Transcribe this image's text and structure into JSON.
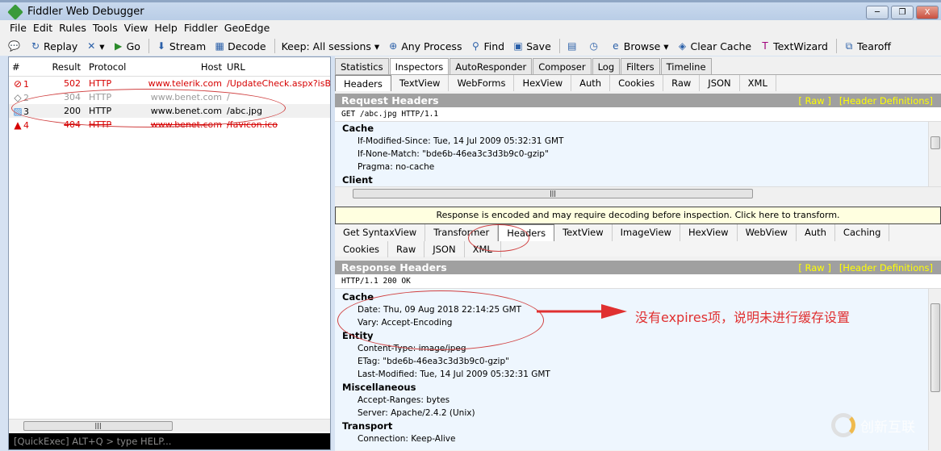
{
  "window": {
    "title": "Fiddler Web Debugger",
    "minimize": "─",
    "restore": "❐",
    "close": "X"
  },
  "menu": [
    "File",
    "Edit",
    "Rules",
    "Tools",
    "View",
    "Help",
    "Fiddler",
    "GeoEdge"
  ],
  "toolbar": [
    {
      "icon": "comment-icon",
      "label": ""
    },
    {
      "icon": "replay-icon",
      "label": "Replay"
    },
    {
      "icon": "remove-icon",
      "label": "▾"
    },
    {
      "icon": "go-icon",
      "label": "Go"
    },
    {
      "icon": "stream-icon",
      "label": "Stream"
    },
    {
      "icon": "decode-icon",
      "label": "Decode"
    },
    {
      "icon": "",
      "label": "Keep: All sessions ▾"
    },
    {
      "icon": "any-process-icon",
      "label": "Any Process"
    },
    {
      "icon": "find-icon",
      "label": "Find"
    },
    {
      "icon": "save-icon",
      "label": "Save"
    },
    {
      "icon": "screenshot-icon",
      "label": ""
    },
    {
      "icon": "timer-icon",
      "label": ""
    },
    {
      "icon": "browse-icon",
      "label": "Browse ▾"
    },
    {
      "icon": "clear-cache-icon",
      "label": "Clear Cache"
    },
    {
      "icon": "textwizard-icon",
      "label": "TextWizard"
    },
    {
      "icon": "tearoff-icon",
      "label": "Tearoff"
    }
  ],
  "sessions": {
    "columns": [
      "#",
      "Result",
      "Protocol",
      "Host",
      "URL"
    ],
    "rows": [
      {
        "id": "1",
        "result": "502",
        "protocol": "HTTP",
        "host": "www.telerik.com",
        "url": "/UpdateCheck.aspx?isBet",
        "icon": "blocked-icon",
        "style": "red"
      },
      {
        "id": "2",
        "result": "304",
        "protocol": "HTTP",
        "host": "www.benet.com",
        "url": "/",
        "icon": "cache-icon",
        "style": "grey"
      },
      {
        "id": "3",
        "result": "200",
        "protocol": "HTTP",
        "host": "www.benet.com",
        "url": "/abc.jpg",
        "icon": "image-icon",
        "style": "normal"
      },
      {
        "id": "4",
        "result": "404",
        "protocol": "HTTP",
        "host": "www.benet.com",
        "url": "/favicon.ico",
        "icon": "warning-icon",
        "style": "red-strike"
      }
    ]
  },
  "quickexec": "[QuickExec] ALT+Q > type HELP...",
  "main_tabs": [
    "Statistics",
    "Inspectors",
    "AutoResponder",
    "Composer",
    "Log",
    "Filters",
    "Timeline"
  ],
  "request": {
    "tabs": [
      "Headers",
      "TextView",
      "WebForms",
      "HexView",
      "Auth",
      "Cookies",
      "Raw",
      "JSON",
      "XML"
    ],
    "title": "Request Headers",
    "raw": "[ Raw ]",
    "defs": "[Header Definitions]",
    "line": "GET /abc.jpg HTTP/1.1",
    "groups": [
      {
        "name": "Cache",
        "items": [
          "If-Modified-Since: Tue, 14 Jul 2009 05:32:31 GMT",
          "If-None-Match: \"bde6b-46ea3c3d3b9c0-gzip\"",
          "Pragma: no-cache"
        ]
      },
      {
        "name": "Client",
        "items": []
      }
    ]
  },
  "notice": "Response is encoded and may require decoding before inspection. Click here to transform.",
  "response": {
    "tabs": [
      "Get SyntaxView",
      "Transformer",
      "Headers",
      "TextView",
      "ImageView",
      "HexView",
      "WebView",
      "Auth",
      "Caching",
      "Cookies",
      "Raw",
      "JSON",
      "XML"
    ],
    "title": "Response Headers",
    "raw": "[ Raw ]",
    "defs": "[Header Definitions]",
    "line": "HTTP/1.1 200 OK",
    "groups": [
      {
        "name": "Cache",
        "items": [
          "Date: Thu, 09 Aug 2018 22:14:25 GMT",
          "Vary: Accept-Encoding"
        ]
      },
      {
        "name": "Entity",
        "items": [
          "Content-Type: image/jpeg",
          "ETag: \"bde6b-46ea3c3d3b9c0-gzip\"",
          "Last-Modified: Tue, 14 Jul 2009 05:32:31 GMT"
        ]
      },
      {
        "name": "Miscellaneous",
        "items": [
          "Accept-Ranges: bytes",
          "Server: Apache/2.4.2 (Unix)"
        ]
      },
      {
        "name": "Transport",
        "items": [
          "Connection: Keep-Alive"
        ]
      }
    ]
  },
  "annotation": "没有expires项，说明未进行缓存设置",
  "watermark": "创新互联",
  "colors": {
    "annotation": "#e03030",
    "header_links": "#ffff00",
    "error": "#d60000"
  }
}
